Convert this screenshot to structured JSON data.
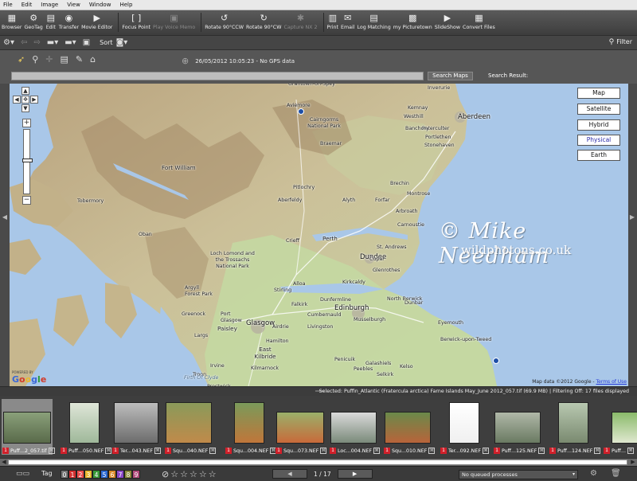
{
  "menu": [
    "File",
    "Edit",
    "Image",
    "View",
    "Window",
    "Help"
  ],
  "toolbar": [
    {
      "label": "Browser",
      "icon": "browser-icon",
      "glyph": "▦",
      "disabled": false
    },
    {
      "label": "GeoTag",
      "icon": "geotag-icon",
      "glyph": "⚙",
      "disabled": false
    },
    {
      "label": "Edit",
      "icon": "edit-icon",
      "glyph": "▤",
      "disabled": false
    },
    {
      "label": "Transfer",
      "icon": "transfer-icon",
      "glyph": "◉",
      "disabled": false
    },
    {
      "label": "Movie Editor",
      "icon": "movie-editor-icon",
      "glyph": "▶",
      "disabled": false
    },
    {
      "label": "Focus Point",
      "icon": "focus-point-icon",
      "glyph": "[ ]",
      "disabled": false
    },
    {
      "label": "Play Voice Memo",
      "icon": "voice-memo-icon",
      "glyph": "▣",
      "disabled": true
    },
    {
      "label": "Rotate 90°CCW",
      "icon": "rotate-ccw-icon",
      "glyph": "↺",
      "disabled": false
    },
    {
      "label": "Rotate 90°CW",
      "icon": "rotate-cw-icon",
      "glyph": "↻",
      "disabled": false
    },
    {
      "label": "Capture NX 2",
      "icon": "capture-nx2-icon",
      "glyph": "✱",
      "disabled": true
    },
    {
      "label": "Print",
      "icon": "print-icon",
      "glyph": "▥",
      "disabled": false
    },
    {
      "label": "Email",
      "icon": "email-icon",
      "glyph": "✉",
      "disabled": false
    },
    {
      "label": "Log Matching",
      "icon": "log-matching-icon",
      "glyph": "▤",
      "disabled": false
    },
    {
      "label": "my Picturetown",
      "icon": "picturetown-icon",
      "glyph": "▩",
      "disabled": false
    },
    {
      "label": "SlideShow",
      "icon": "slideshow-icon",
      "glyph": "▶",
      "disabled": false
    },
    {
      "label": "Convert Files",
      "icon": "convert-files-icon",
      "glyph": "▦",
      "disabled": false
    }
  ],
  "toolbar2": {
    "sort_label": "Sort",
    "filter_label": "Filter"
  },
  "gps_info": "26/05/2012 10:05:23 - No GPS data",
  "search": {
    "button": "Search Maps",
    "result_label": "Search Result:",
    "value": ""
  },
  "map_types": [
    {
      "label": "Map",
      "active": false
    },
    {
      "label": "Satellite",
      "active": false
    },
    {
      "label": "Hybrid",
      "active": false
    },
    {
      "label": "Physical",
      "active": true
    },
    {
      "label": "Earth",
      "active": false
    }
  ],
  "places": [
    {
      "name": "Grantown-on-Spey",
      "cls": ""
    },
    {
      "name": "Aviemore",
      "cls": ""
    },
    {
      "name": "Cairngorms National Park",
      "cls": ""
    },
    {
      "name": "Braemar",
      "cls": ""
    },
    {
      "name": "Inverurie",
      "cls": ""
    },
    {
      "name": "Kemnay",
      "cls": ""
    },
    {
      "name": "Westhill",
      "cls": ""
    },
    {
      "name": "Aberdeen",
      "cls": "big"
    },
    {
      "name": "Peterculter",
      "cls": ""
    },
    {
      "name": "Banchory",
      "cls": ""
    },
    {
      "name": "Portlethen",
      "cls": ""
    },
    {
      "name": "Stonehaven",
      "cls": ""
    },
    {
      "name": "Fort William",
      "cls": "mid"
    },
    {
      "name": "Tobermory",
      "cls": ""
    },
    {
      "name": "Oban",
      "cls": ""
    },
    {
      "name": "Pitlochry",
      "cls": ""
    },
    {
      "name": "Aberfeldy",
      "cls": ""
    },
    {
      "name": "Alyth",
      "cls": ""
    },
    {
      "name": "Forfar",
      "cls": ""
    },
    {
      "name": "Brechin",
      "cls": ""
    },
    {
      "name": "Montrose",
      "cls": ""
    },
    {
      "name": "Arbroath",
      "cls": ""
    },
    {
      "name": "Carnoustie",
      "cls": ""
    },
    {
      "name": "Dundee",
      "cls": "big"
    },
    {
      "name": "Perth",
      "cls": "mid"
    },
    {
      "name": "St. Andrews",
      "cls": ""
    },
    {
      "name": "Crieff",
      "cls": ""
    },
    {
      "name": "Cupar",
      "cls": ""
    },
    {
      "name": "Loch Lomond and the Trossachs National Park",
      "cls": ""
    },
    {
      "name": "Glenrothes",
      "cls": ""
    },
    {
      "name": "Kirkcaldy",
      "cls": ""
    },
    {
      "name": "Alloa",
      "cls": ""
    },
    {
      "name": "Stirling",
      "cls": ""
    },
    {
      "name": "Falkirk",
      "cls": ""
    },
    {
      "name": "Dunfermline",
      "cls": ""
    },
    {
      "name": "Argyll Forest Park",
      "cls": ""
    },
    {
      "name": "Edinburgh",
      "cls": "big"
    },
    {
      "name": "Musselburgh",
      "cls": ""
    },
    {
      "name": "North Berwick",
      "cls": ""
    },
    {
      "name": "Dunbar",
      "cls": ""
    },
    {
      "name": "Greenock",
      "cls": ""
    },
    {
      "name": "Port Glasgow",
      "cls": ""
    },
    {
      "name": "Paisley",
      "cls": "mid"
    },
    {
      "name": "Glasgow",
      "cls": "big"
    },
    {
      "name": "Cumbernauld",
      "cls": ""
    },
    {
      "name": "Livingston",
      "cls": ""
    },
    {
      "name": "Airdrie",
      "cls": ""
    },
    {
      "name": "Hamilton",
      "cls": ""
    },
    {
      "name": "East Kilbride",
      "cls": "mid"
    },
    {
      "name": "Largs",
      "cls": ""
    },
    {
      "name": "Eyemouth",
      "cls": ""
    },
    {
      "name": "Berwick-upon-Tweed",
      "cls": ""
    },
    {
      "name": "Penicuik",
      "cls": ""
    },
    {
      "name": "Peebles",
      "cls": ""
    },
    {
      "name": "Galashiels",
      "cls": ""
    },
    {
      "name": "Kelso",
      "cls": ""
    },
    {
      "name": "Selkirk",
      "cls": ""
    },
    {
      "name": "Irvine",
      "cls": ""
    },
    {
      "name": "Kilmarnock",
      "cls": ""
    },
    {
      "name": "Troon",
      "cls": ""
    },
    {
      "name": "Prestwick",
      "cls": ""
    },
    {
      "name": "Firth Of Clyde",
      "cls": ""
    }
  ],
  "watermark": {
    "line1": "© Mike Needham",
    "line2": "wildphotons.co.uk"
  },
  "google": {
    "powered_by": "POWERED BY",
    "logo": "Google"
  },
  "map_data": {
    "text": "Map data ©2012 Google - ",
    "terms": "Terms of Use"
  },
  "selection_status": "Selected: Puffin_Atlantic (Fratercula arctica) Farne Islands May_June 2012_057.tif (69.9 MB) | Filtering Off: 17 files displayed",
  "thumbnails": [
    {
      "caption": "Puff...2_057.tif",
      "selected": true
    },
    {
      "caption": "Puff...050.NEF",
      "selected": false
    },
    {
      "caption": "Ter...043.NEF",
      "selected": false
    },
    {
      "caption": "Squ...040.NEF",
      "selected": false
    },
    {
      "caption": "Squ...004.NEF",
      "selected": false
    },
    {
      "caption": "Squ...073.NEF",
      "selected": false
    },
    {
      "caption": "Loc...004.NEF",
      "selected": false
    },
    {
      "caption": "Squ...010.NEF",
      "selected": false
    },
    {
      "caption": "Ter...092.NEF",
      "selected": false
    },
    {
      "caption": "Puff...125.NEF",
      "selected": false
    },
    {
      "caption": "Puff...124.NEF",
      "selected": false
    },
    {
      "caption": "Puff...",
      "selected": false
    }
  ],
  "bottombar": {
    "tag_label": "Tag",
    "labels": [
      "0",
      "1",
      "2",
      "3",
      "4",
      "5",
      "6",
      "7",
      "8",
      "9"
    ],
    "label_colors": [
      "#777777",
      "#d32f2f",
      "#e94e4e",
      "#e9b830",
      "#3a9a3a",
      "#2f6ad3",
      "#d98a2a",
      "#8a48c8",
      "#8a8a3a",
      "#b04a7a"
    ],
    "page": "1 / 17",
    "queue_status": "No queued processes"
  }
}
